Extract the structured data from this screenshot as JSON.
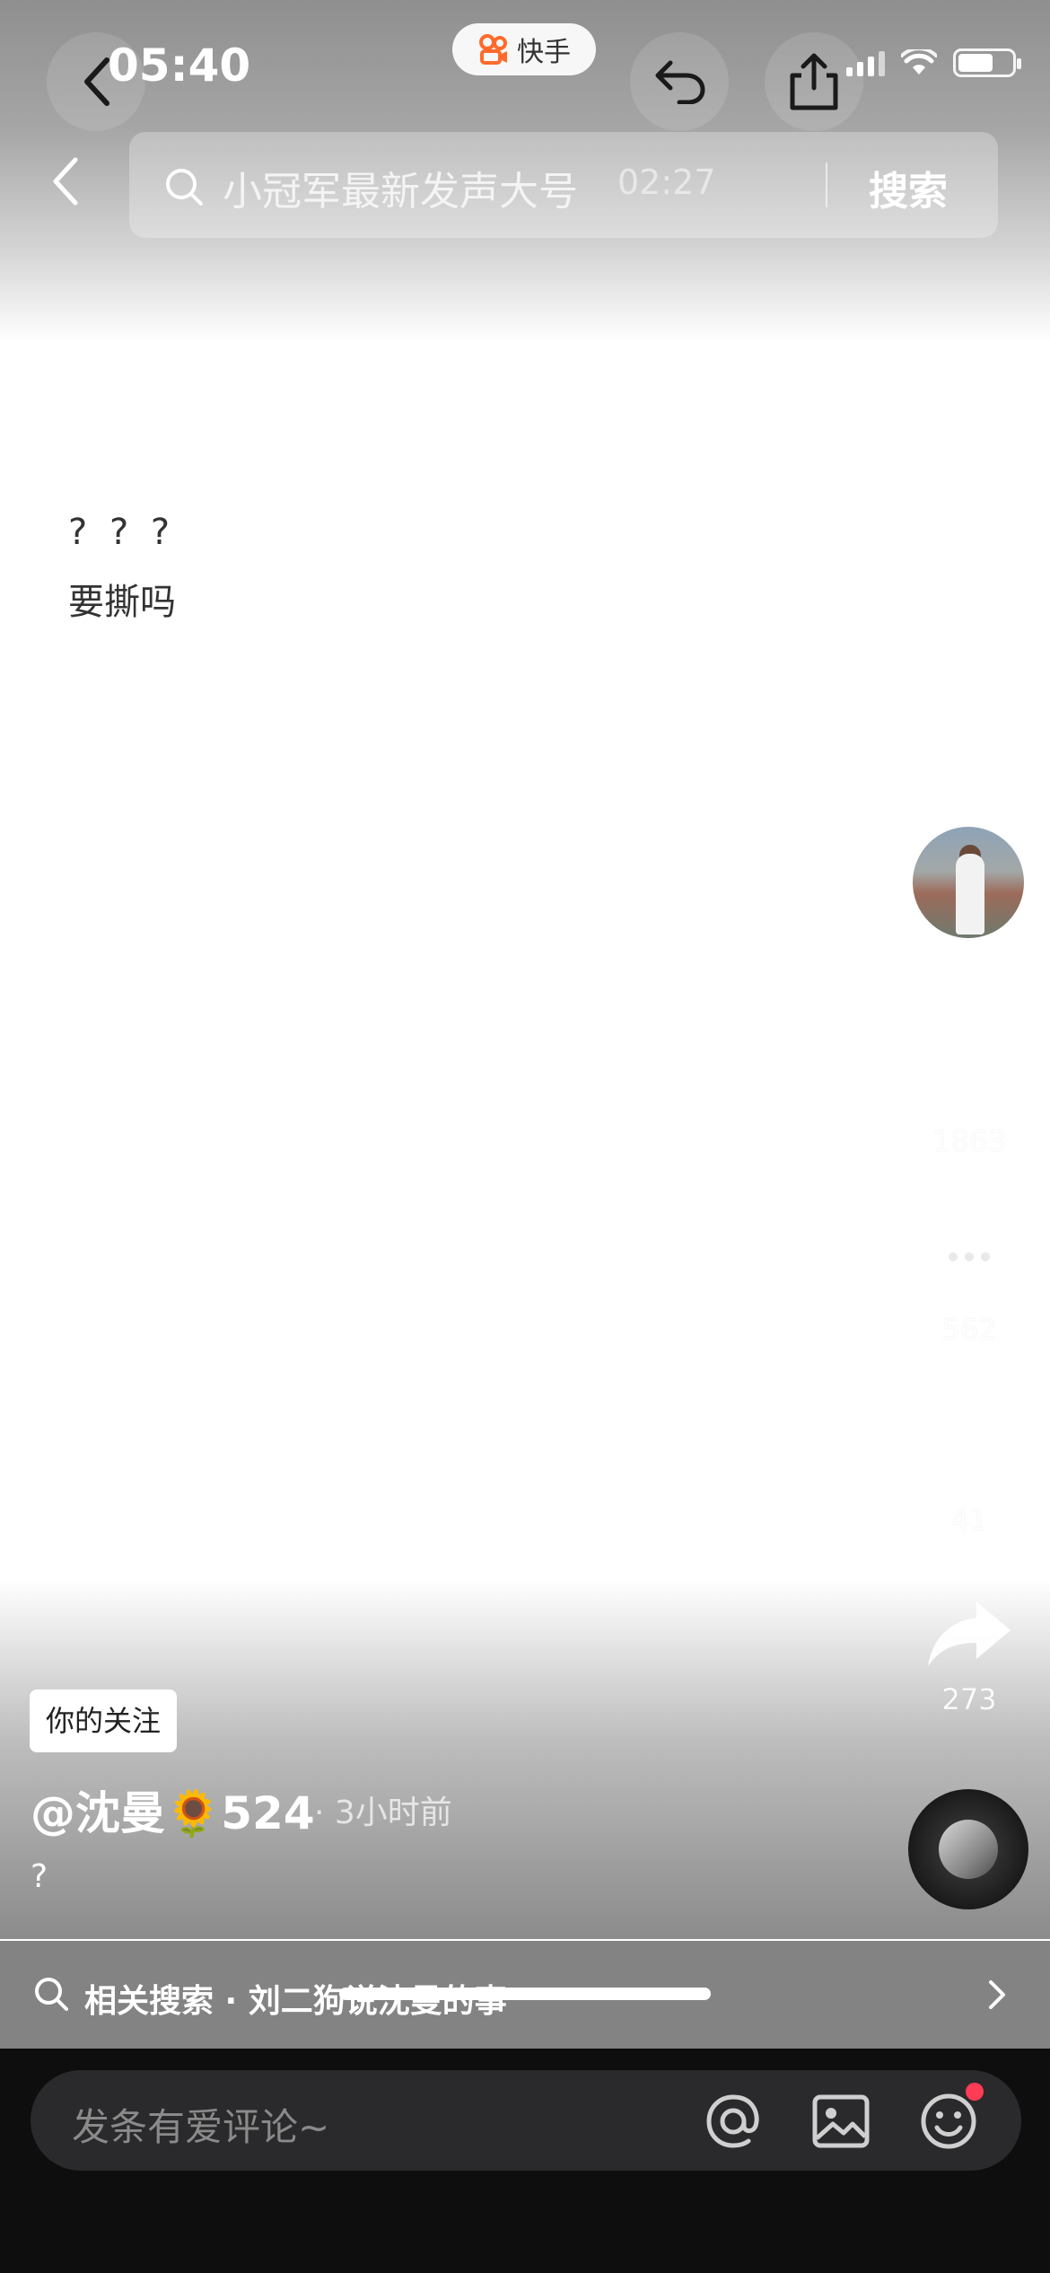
{
  "status_bar": {
    "time": "05:40"
  },
  "app_pill": {
    "label": "快手"
  },
  "search": {
    "query": "小冠军最新发声大号",
    "overlay_time": "02:27",
    "button_label": "搜索"
  },
  "post": {
    "line1": "? ? ?",
    "line2": "要撕吗"
  },
  "actions": {
    "likes": "1863",
    "comments": "562",
    "favorites": "41",
    "shares": "273"
  },
  "author": {
    "follow_tag": "你的关注",
    "name": "@沈曼🌻524",
    "time": "· 3小时前",
    "caption": "?"
  },
  "related": {
    "text": "相关搜索 · 刘二狗说沈曼的事"
  },
  "comment_bar": {
    "placeholder": "发条有爱评论~"
  },
  "colors": {
    "accent_red": "#ff3b55",
    "kuaishou_orange": "#ff6a2b"
  }
}
